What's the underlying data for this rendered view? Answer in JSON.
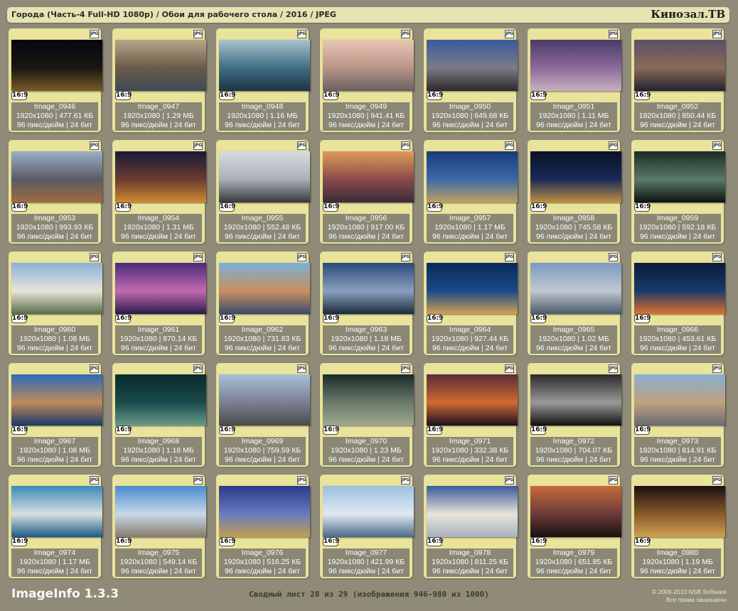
{
  "header": {
    "title": "Города (Часть-4 Full-HD 1080p) / Обои для рабочего стола / 2016 / JPEG",
    "logo": "Кинозал.ТВ"
  },
  "file_icon": "JPG",
  "aspect_label": "16:9",
  "images": [
    {
      "name": "Image_0946",
      "size": "1920x1080 | 477.61 КБ",
      "meta": "96 пикс/дюйм | 24 бит",
      "colors": [
        "#05060f",
        "#1a1610",
        "#7a5a2a"
      ]
    },
    {
      "name": "Image_0947",
      "size": "1920x1080 | 1.29 МБ",
      "meta": "96 пикс/дюйм | 24 бит",
      "colors": [
        "#b8a68a",
        "#6a5a48",
        "#3c4a56"
      ]
    },
    {
      "name": "Image_0948",
      "size": "1920x1080 | 1.16 МБ",
      "meta": "96 пикс/дюйм | 24 бит",
      "colors": [
        "#a9c4cf",
        "#3e6e82",
        "#1d3544"
      ]
    },
    {
      "name": "Image_0949",
      "size": "1920x1080 | 941.41 КБ",
      "meta": "96 пикс/дюйм | 24 бит",
      "colors": [
        "#e8c6b0",
        "#b9958a",
        "#6a6060"
      ]
    },
    {
      "name": "Image_0950",
      "size": "1920x1080 | 649.68 КБ",
      "meta": "96 пикс/дюйм | 24 бит",
      "colors": [
        "#3a5aa0",
        "#7d7a88",
        "#2c2a2a"
      ]
    },
    {
      "name": "Image_0951",
      "size": "1920x1080 | 1.11 МБ",
      "meta": "96 пикс/дюйм | 24 бит",
      "colors": [
        "#4a3a6a",
        "#8c6a9a",
        "#c8b0c0"
      ]
    },
    {
      "name": "Image_0952",
      "size": "1920x1080 | 850.44 КБ",
      "meta": "96 пикс/дюйм | 24 бит",
      "colors": [
        "#5a5068",
        "#8a6a58",
        "#222230"
      ]
    },
    {
      "name": "Image_0953",
      "size": "1920x1080 | 993.93 КБ",
      "meta": "96 пикс/дюйм | 24 бит",
      "colors": [
        "#9ab0c8",
        "#5a5a66",
        "#a06a40"
      ]
    },
    {
      "name": "Image_0954",
      "size": "1920x1080 | 1.31 МБ",
      "meta": "96 пикс/дюйм | 24 бит",
      "colors": [
        "#1a1a3a",
        "#6a3a30",
        "#d08a30"
      ]
    },
    {
      "name": "Image_0955",
      "size": "1920x1080 | 552.48 КБ",
      "meta": "96 пикс/дюйм | 24 бит",
      "colors": [
        "#d8dce0",
        "#a8b0b8",
        "#383838"
      ]
    },
    {
      "name": "Image_0956",
      "size": "1920x1080 | 917.00 КБ",
      "meta": "96 пикс/дюйм | 24 бит",
      "colors": [
        "#e09a5a",
        "#8a4a4a",
        "#3a2a3a"
      ]
    },
    {
      "name": "Image_0957",
      "size": "1920x1080 | 1.17 МБ",
      "meta": "96 пикс/дюйм | 24 бит",
      "colors": [
        "#1a3a7a",
        "#3a6aa8",
        "#c0a060"
      ]
    },
    {
      "name": "Image_0958",
      "size": "1920x1080 | 745.58 КБ",
      "meta": "96 пикс/дюйм | 24 бит",
      "colors": [
        "#0a1026",
        "#1a2a5a",
        "#c09040"
      ]
    },
    {
      "name": "Image_0959",
      "size": "1920x1080 | 592.18 КБ",
      "meta": "96 пикс/дюйм | 24 бит",
      "colors": [
        "#1c2a26",
        "#5a7a6a",
        "#0c1210"
      ]
    },
    {
      "name": "Image_0960",
      "size": "1920x1080 | 1.08 МБ",
      "meta": "96 пикс/дюйм | 24 бит",
      "colors": [
        "#8ab0d8",
        "#e8e4d8",
        "#5a6a4a"
      ]
    },
    {
      "name": "Image_0961",
      "size": "1920x1080 | 870.14 КБ",
      "meta": "96 пикс/дюйм | 24 бит",
      "colors": [
        "#4a2a7a",
        "#c06ab0",
        "#2a1a4a"
      ]
    },
    {
      "name": "Image_0962",
      "size": "1920x1080 | 731.83 КБ",
      "meta": "96 пикс/дюйм | 24 бит",
      "colors": [
        "#7ab0d8",
        "#c89060",
        "#3a4a6a"
      ]
    },
    {
      "name": "Image_0963",
      "size": "1920x1080 | 1.18 МБ",
      "meta": "96 пикс/дюйм | 24 бит",
      "colors": [
        "#2a4a7a",
        "#8aa0c0",
        "#1a2a3a"
      ]
    },
    {
      "name": "Image_0964",
      "size": "1920x1080 | 927.44 КБ",
      "meta": "96 пикс/дюйм | 24 бит",
      "colors": [
        "#0a2a5a",
        "#1a4a8a",
        "#d0a050"
      ]
    },
    {
      "name": "Image_0965",
      "size": "1920x1080 | 1.02 МБ",
      "meta": "96 пикс/дюйм | 24 бит",
      "colors": [
        "#7a9ac0",
        "#c0c8d0",
        "#4a5a6a"
      ]
    },
    {
      "name": "Image_0966",
      "size": "1920x1080 | 453.61 КБ",
      "meta": "96 пикс/дюйм | 24 бит",
      "colors": [
        "#0a1a3a",
        "#1a3a6a",
        "#e07030"
      ]
    },
    {
      "name": "Image_0967",
      "size": "1920x1080 | 1.08 МБ",
      "meta": "96 пикс/дюйм | 24 бит",
      "colors": [
        "#2a6ab8",
        "#c08a5a",
        "#1a3a6a"
      ]
    },
    {
      "name": "Image_0968",
      "size": "1920x1080 | 1.18 МБ",
      "meta": "96 пикс/дюйм | 24 бит",
      "colors": [
        "#0a2a2a",
        "#1a4a4a",
        "#6a9a8a"
      ]
    },
    {
      "name": "Image_0969",
      "size": "1920x1080 | 759.59 КБ",
      "meta": "96 пикс/дюйм | 24 бит",
      "colors": [
        "#a8c0d8",
        "#7a8090",
        "#4a4a4a"
      ]
    },
    {
      "name": "Image_0970",
      "size": "1920x1080 | 1.23 МБ",
      "meta": "96 пикс/дюйм | 24 бит",
      "colors": [
        "#1a2a2a",
        "#6a7a6a",
        "#a0a890"
      ]
    },
    {
      "name": "Image_0971",
      "size": "1920x1080 | 332.38 КБ",
      "meta": "96 пикс/дюйм | 24 бит",
      "colors": [
        "#5a2a3a",
        "#d06a30",
        "#1a1020"
      ]
    },
    {
      "name": "Image_0972",
      "size": "1920x1080 | 704.07 КБ",
      "meta": "96 пикс/дюйм | 24 бит",
      "colors": [
        "#2a2a2a",
        "#9a9a9a",
        "#101010"
      ]
    },
    {
      "name": "Image_0973",
      "size": "1920x1080 | 814.91 КБ",
      "meta": "96 пикс/дюйм | 24 бит",
      "colors": [
        "#8ab0d0",
        "#c0a080",
        "#6a6a70"
      ]
    },
    {
      "name": "Image_0974",
      "size": "1920x1080 | 1.17 МБ",
      "meta": "96 пикс/дюйм | 24 бит",
      "colors": [
        "#3a8ab8",
        "#d8e0e0",
        "#1a5a8a"
      ]
    },
    {
      "name": "Image_0975",
      "size": "1920x1080 | 549.14 КБ",
      "meta": "96 пикс/дюйм | 24 бит",
      "colors": [
        "#4a8ad0",
        "#c8d8e8",
        "#8a7a6a"
      ]
    },
    {
      "name": "Image_0976",
      "size": "1920x1080 | 516.25 КБ",
      "meta": "96 пикс/дюйм | 24 бит",
      "colors": [
        "#2a3a8a",
        "#6a7ac0",
        "#c0a050"
      ]
    },
    {
      "name": "Image_0977",
      "size": "1920x1080 | 421.99 КБ",
      "meta": "96 пикс/дюйм | 24 бит",
      "colors": [
        "#9ac0e0",
        "#e0e8f0",
        "#4a6a8a"
      ]
    },
    {
      "name": "Image_0978",
      "size": "1920x1080 | 811.25 КБ",
      "meta": "96 пикс/дюйм | 24 бит",
      "colors": [
        "#3a5a9a",
        "#e8e4d8",
        "#a8b0c0"
      ]
    },
    {
      "name": "Image_0979",
      "size": "1920x1080 | 651.85 КБ",
      "meta": "96 пикс/дюйм | 24 бит",
      "colors": [
        "#c86a3a",
        "#6a3a3a",
        "#1a1010"
      ]
    },
    {
      "name": "Image_0980",
      "size": "1920x1080 | 1.19 МБ",
      "meta": "96 пикс/дюйм | 24 бит",
      "colors": [
        "#1a1010",
        "#8a5a2a",
        "#d0a050"
      ]
    }
  ],
  "footer": {
    "brand": "ImageInfo 1.3.3",
    "summary": "Сводный лист 28 из 29 (изображения 946-980 из 1000)",
    "copyright": "© 2009-2010 NSB Software",
    "rights": "Все права защищены"
  }
}
